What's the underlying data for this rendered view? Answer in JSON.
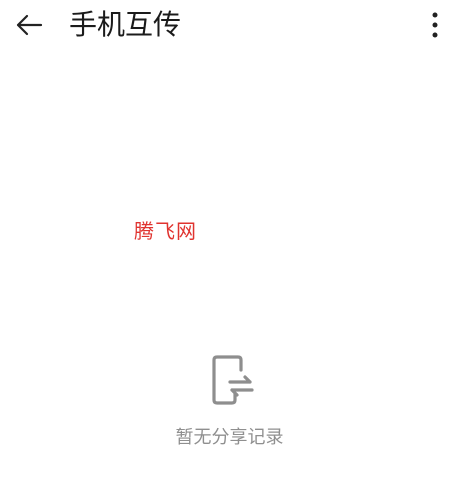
{
  "header": {
    "title": "手机互传",
    "back_icon": "arrow-left-icon",
    "more_icon": "more-vertical-icon"
  },
  "watermark": {
    "text": "腾飞网"
  },
  "empty_state": {
    "icon": "phone-transfer-icon",
    "message": "暂无分享记录"
  },
  "colors": {
    "background": "#ffffff",
    "title": "#1b1b1b",
    "icon": "#222222",
    "empty_icon": "#8e8e8e",
    "empty_text": "#8f8f8f",
    "watermark": "#e0332f"
  }
}
